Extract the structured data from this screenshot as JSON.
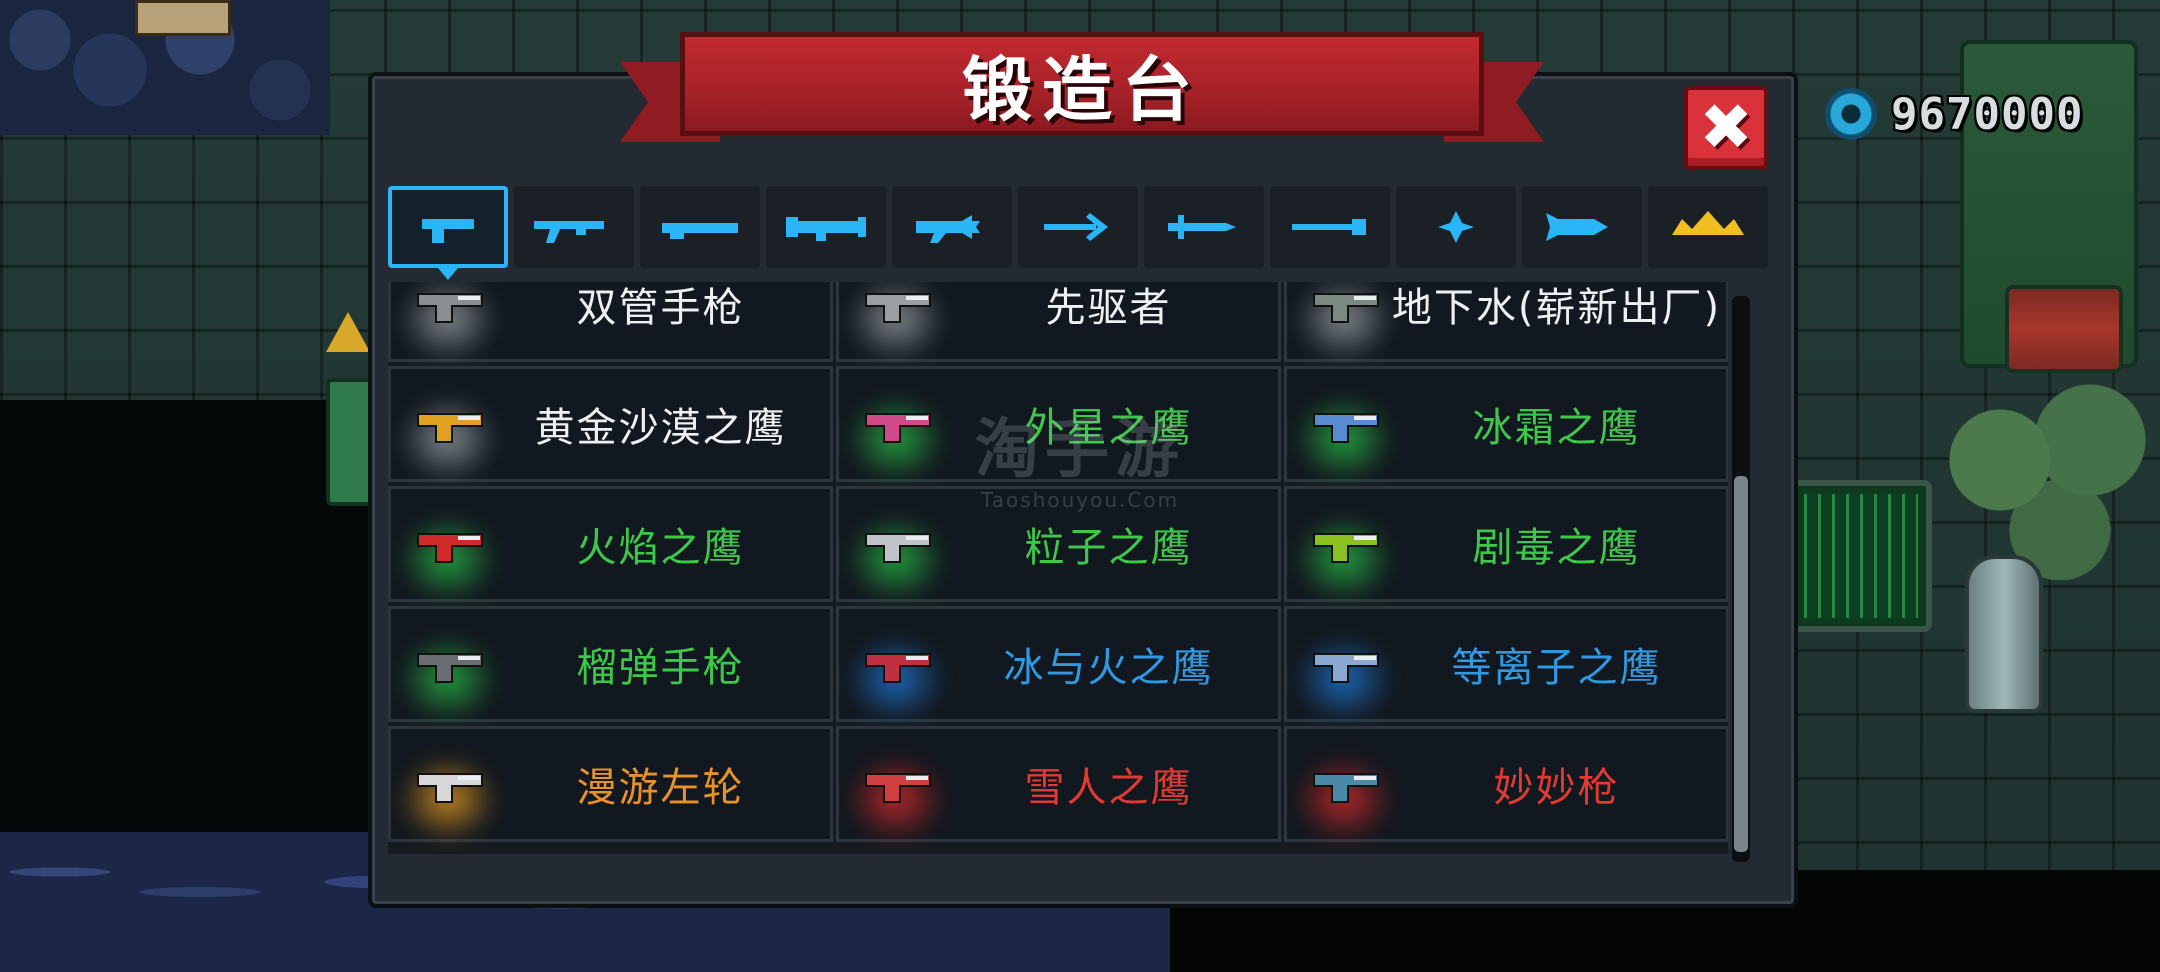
{
  "header": {
    "title": "锻造台"
  },
  "currency": {
    "value": "9670000",
    "icon": "gem-icon"
  },
  "close": {
    "icon": "close-icon",
    "glyph": "✖"
  },
  "tabs": [
    {
      "icon": "pistol-icon",
      "active": true
    },
    {
      "icon": "rifle-icon",
      "active": false
    },
    {
      "icon": "shotgun-icon",
      "active": false
    },
    {
      "icon": "launcher-icon",
      "active": false
    },
    {
      "icon": "laser-gun-icon",
      "active": false
    },
    {
      "icon": "bow-icon",
      "active": false
    },
    {
      "icon": "sword-icon",
      "active": false
    },
    {
      "icon": "staff-icon",
      "active": false
    },
    {
      "icon": "shuriken-icon",
      "active": false
    },
    {
      "icon": "fish-icon",
      "active": false
    },
    {
      "icon": "crown-icon",
      "active": false
    }
  ],
  "weapons": [
    {
      "name": "双管手枪",
      "rarity": "white",
      "glow": "none",
      "color": "#8a8f94"
    },
    {
      "name": "先驱者",
      "rarity": "white",
      "glow": "none",
      "color": "#9a9fa4"
    },
    {
      "name": "地下水(崭新出厂)",
      "rarity": "white",
      "glow": "none",
      "color": "#7a8a80"
    },
    {
      "name": "黄金沙漠之鹰",
      "rarity": "white",
      "glow": "none",
      "color": "#e0a020"
    },
    {
      "name": "外星之鹰",
      "rarity": "green",
      "glow": "green",
      "color": "#d04a8a"
    },
    {
      "name": "冰霜之鹰",
      "rarity": "green",
      "glow": "green",
      "color": "#5a8ad0"
    },
    {
      "name": "火焰之鹰",
      "rarity": "green",
      "glow": "green",
      "color": "#d02a2a"
    },
    {
      "name": "粒子之鹰",
      "rarity": "green",
      "glow": "green",
      "color": "#c0c4c8"
    },
    {
      "name": "剧毒之鹰",
      "rarity": "green",
      "glow": "green",
      "color": "#8ac020"
    },
    {
      "name": "榴弹手枪",
      "rarity": "green",
      "glow": "green",
      "color": "#6a6e72"
    },
    {
      "name": "冰与火之鹰",
      "rarity": "blue",
      "glow": "blue",
      "color": "#c03040"
    },
    {
      "name": "等离子之鹰",
      "rarity": "blue",
      "glow": "blue",
      "color": "#8aa8d0"
    },
    {
      "name": "漫游左轮",
      "rarity": "orange",
      "glow": "orange",
      "color": "#d8d8d8"
    },
    {
      "name": "雪人之鹰",
      "rarity": "red",
      "glow": "red",
      "color": "#d04040"
    },
    {
      "name": "妙妙枪",
      "rarity": "red",
      "glow": "red",
      "color": "#4a8aa8"
    }
  ],
  "watermark": {
    "main": "淘手游",
    "sub": "Taoshouyou.Com"
  },
  "colors": {
    "accent": "#2ab6f6",
    "banner": "#a52228",
    "panel": "#232a31"
  }
}
